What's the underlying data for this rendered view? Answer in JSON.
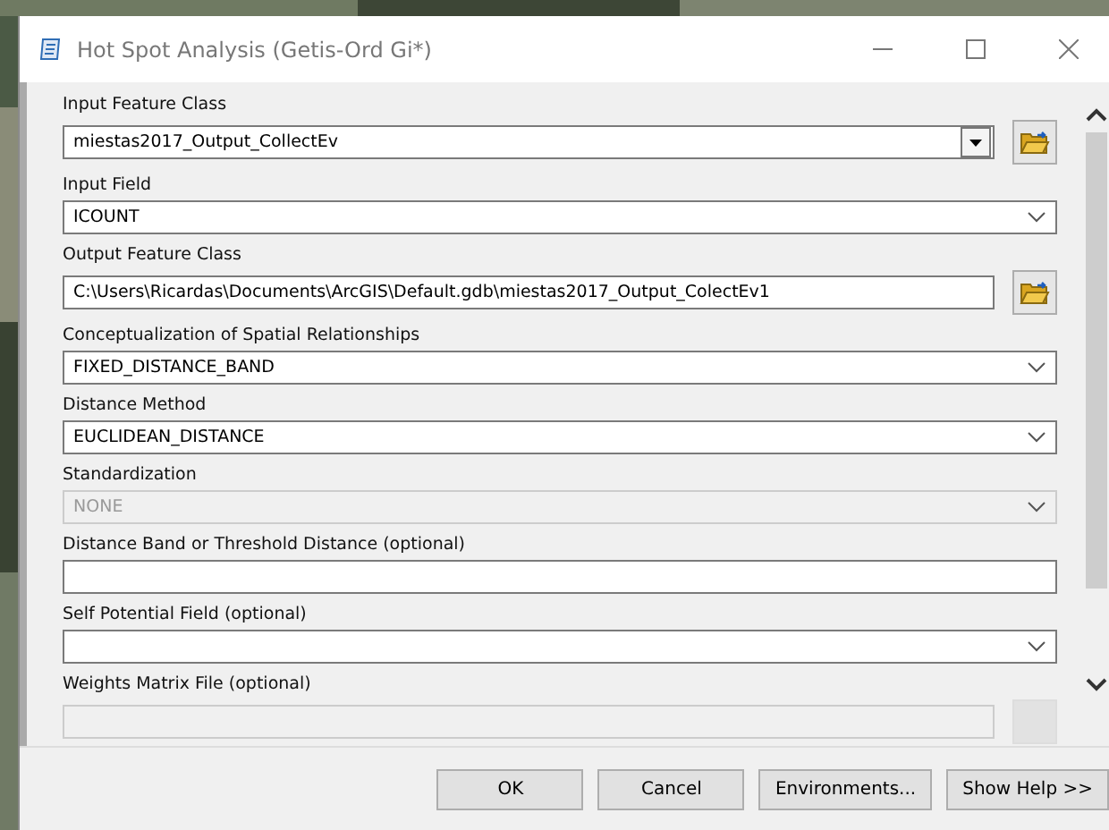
{
  "window": {
    "title": "Hot Spot Analysis (Getis-Ord Gi*)"
  },
  "fields": [
    {
      "label": "Input Feature Class",
      "kind": "classic-dropdown",
      "value": "miestas2017_Output_CollectEv",
      "browse": true,
      "disabled": false
    },
    {
      "label": "Input Field",
      "kind": "dropdown",
      "value": "ICOUNT",
      "browse": false,
      "disabled": false
    },
    {
      "label": "Output Feature Class",
      "kind": "text",
      "value": "C:\\Users\\Ricardas\\Documents\\ArcGIS\\Default.gdb\\miestas2017_Output_ColectEv1",
      "browse": true,
      "disabled": false
    },
    {
      "label": "Conceptualization of Spatial Relationships",
      "kind": "dropdown",
      "value": "FIXED_DISTANCE_BAND",
      "browse": false,
      "disabled": false
    },
    {
      "label": "Distance Method",
      "kind": "dropdown",
      "value": "EUCLIDEAN_DISTANCE",
      "browse": false,
      "disabled": false
    },
    {
      "label": "Standardization",
      "kind": "dropdown",
      "value": "NONE",
      "browse": false,
      "disabled": true
    },
    {
      "label": "Distance Band or Threshold Distance (optional)",
      "kind": "text",
      "browse": false,
      "disabled": false
    },
    {
      "label": "Self Potential Field (optional)",
      "kind": "dropdown",
      "browse": false,
      "disabled": false
    },
    {
      "label": "Weights Matrix File (optional)",
      "kind": "text",
      "browse": true,
      "disabled": true
    }
  ],
  "buttons": [
    "OK",
    "Cancel",
    "Environments...",
    "Show Help >>"
  ]
}
